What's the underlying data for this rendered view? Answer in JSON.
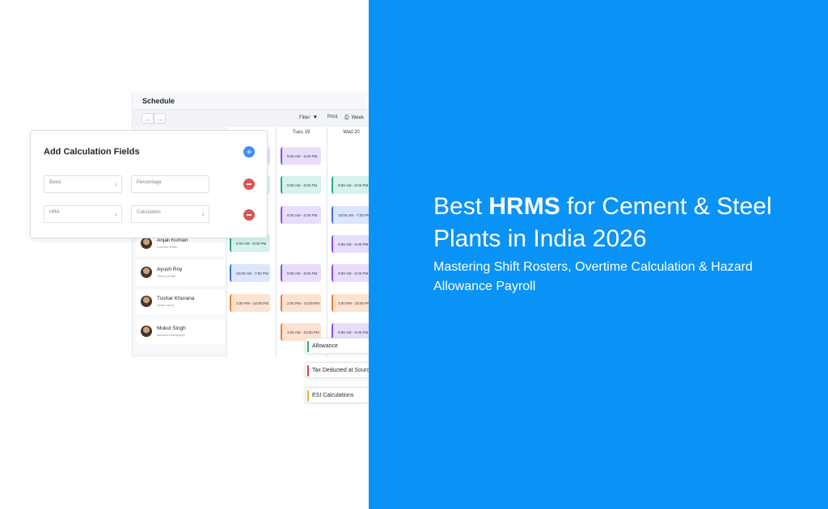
{
  "schedule": {
    "title": "Schedule",
    "filter_label": "Filter",
    "print_label": "Print",
    "week_label": "Week",
    "days": [
      "Tues 19",
      "Wed 20"
    ],
    "employees": [
      {
        "name": "Anjali Kumari",
        "role": "Content Writer"
      },
      {
        "name": "Ayush Roy",
        "role": "Team Leader"
      },
      {
        "name": "Tushar Khurana",
        "role": "Sales Head"
      },
      {
        "name": "Mukul Singh",
        "role": "Backend Developer"
      }
    ],
    "shifts": {
      "s1": "9:00 AM - 6:00 PM",
      "s2": "9:00 AM - 6:00 PM",
      "s3": "9:00 AM - 6:00 PM",
      "s4": "9:00 AM - 6:00 PM",
      "s5": "10:00 AM - 7:00 PM",
      "s6": "9:00 AM - 6:00 PM",
      "s7": "9:00 AM - 6:00 PM",
      "s8": "10:00 AM - 7:00 PM",
      "s9": "9:00 AM - 6:00 PM",
      "s10": "9:00 AM - 6:00 PM",
      "s11": "2:00 PM - 10:00 PM",
      "s12": "2:00 PM - 10:00 PM",
      "s13": "2:00 PM - 10:00 PM",
      "s14": "3:00 AM - 10:00 PM",
      "s15": "9:00 AM - 6:00 PM"
    }
  },
  "calc_card": {
    "title": "Add Calculation Fields",
    "row1": {
      "field": "Basic",
      "type": "Percentage"
    },
    "row2": {
      "field": "HRA",
      "type": "Calculation"
    }
  },
  "tags": [
    {
      "label": "Allowance",
      "color": "#2bb34a"
    },
    {
      "label": "Tax Deducted at Source",
      "color": "#e23c3c"
    },
    {
      "label": "ESI Calculations",
      "color": "#f0b21a"
    }
  ],
  "hero": {
    "headline_pre": "Best ",
    "headline_bold": "HRMS",
    "headline_post": " for Cement & Steel Plants in India 2026",
    "subheadline": "Mastering Shift Rosters, Overtime Calculation & Hazard Allowance Payroll"
  },
  "colors": {
    "brand_blue": "#0a93f6",
    "add_button": "#3d8ef5",
    "remove_button": "#e05353"
  }
}
